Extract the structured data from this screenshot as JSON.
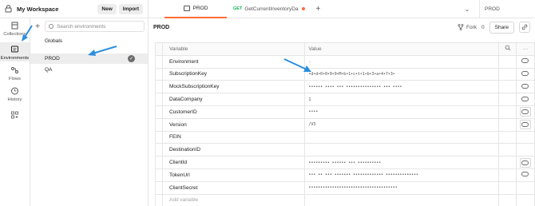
{
  "workspace": {
    "title": "My Workspace",
    "new_label": "New",
    "import_label": "Import"
  },
  "tabs": [
    {
      "label": "PROD",
      "active": true
    },
    {
      "method": "GET",
      "label": "GetCurrentInventoryDa",
      "unsaved": true
    }
  ],
  "env_selector": "PROD",
  "rail": {
    "collections": "Collections",
    "environments": "Environments",
    "flows": "Flows",
    "history": "History"
  },
  "envlist": {
    "search_placeholder": "Search environments",
    "globals": "Globals",
    "items": [
      "PROD",
      "QA"
    ]
  },
  "main": {
    "env_name": "PROD",
    "fork_label": "Fork",
    "fork_count": "0",
    "share_label": "Share",
    "col_variable": "Variable",
    "col_value": "Value",
    "add_variable": "Add variable",
    "rows": [
      {
        "name": "Environment",
        "value": "."
      },
      {
        "name": "SubscriptionKey",
        "value": "•d•d•0•0•0•9•M•b•1•c•t•1•b•3•a•4•7•3•"
      },
      {
        "name": "MockSubscriptionKey",
        "value": "•••••• •••• ••• ••••••••••••••• ••• ••••"
      },
      {
        "name": "DataCompany",
        "value": "1"
      },
      {
        "name": "CustomerID",
        "value": "••••"
      },
      {
        "name": "Version",
        "value": "/V3"
      },
      {
        "name": "FEIN",
        "value": ""
      },
      {
        "name": "DestinationID",
        "value": ""
      },
      {
        "name": "ClientId",
        "value": "•••••••••  ••••••  ••• ••••••••••"
      },
      {
        "name": "TokenUrl",
        "value": "••• •• •••   •••••••      •••••••••••••  ••••••••••••••"
      },
      {
        "name": "ClientSecret",
        "value": "••••••••••••••••••••••••••••••••••••••"
      }
    ]
  },
  "colors": {
    "accent": "#ff6c37",
    "arrow": "#2b8fe0",
    "get_method": "#0cbb52"
  }
}
